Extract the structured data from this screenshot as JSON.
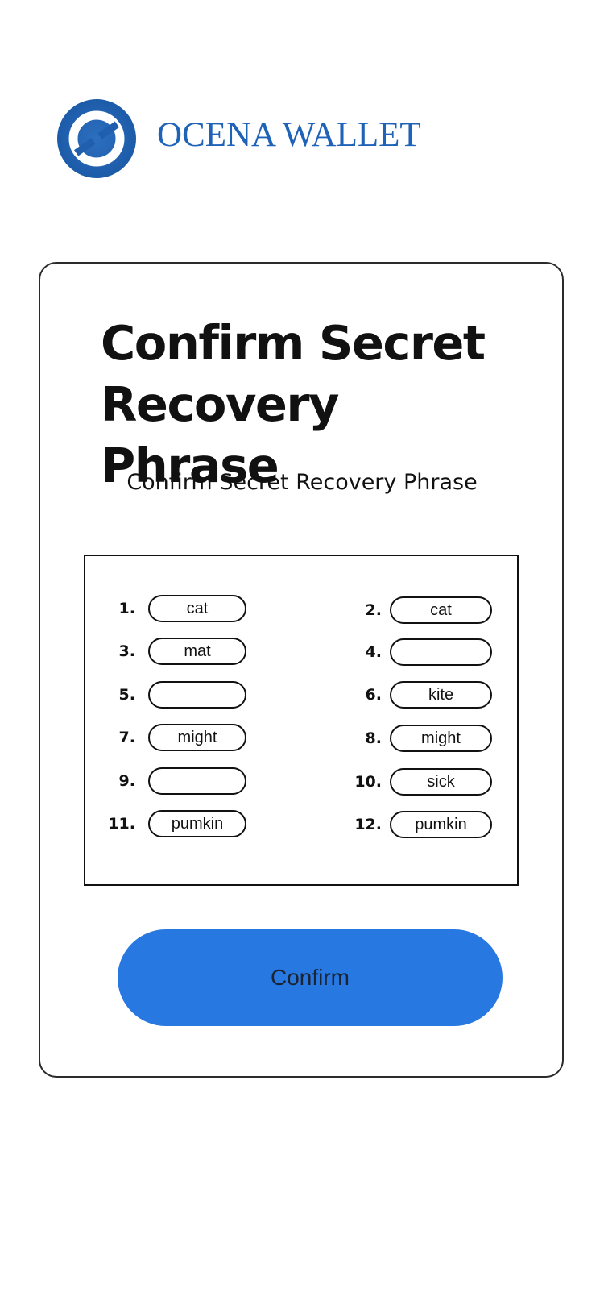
{
  "brand": {
    "name": "OCENA WALLET",
    "logo_icon": "ring-logo-icon",
    "color": "#1f63b8"
  },
  "card": {
    "title": "Confirm Secret Recovery Phrase",
    "subtitle": "Confirm Secret Recovery Phrase"
  },
  "words": [
    {
      "number": "1.",
      "value": ""
    },
    {
      "number": "2.",
      "value": ""
    },
    {
      "number": "3.",
      "value": ""
    },
    {
      "number": "4.",
      "value": ""
    },
    {
      "number": "5.",
      "value": ""
    },
    {
      "number": "6.",
      "value": ""
    },
    {
      "number": "7.",
      "value": ""
    },
    {
      "number": "8.",
      "value": ""
    },
    {
      "number": "9.",
      "value": ""
    },
    {
      "number": "10.",
      "value": ""
    },
    {
      "number": "11.",
      "value": ""
    },
    {
      "number": "12.",
      "value": ""
    }
  ],
  "word_values": [
    "cat",
    "cat",
    "mat",
    "",
    "",
    "kite",
    "might",
    "might",
    "",
    "sick",
    "pumkin",
    "pumkin"
  ],
  "confirm_button": {
    "label": "Confirm",
    "color": "#2878e2"
  }
}
